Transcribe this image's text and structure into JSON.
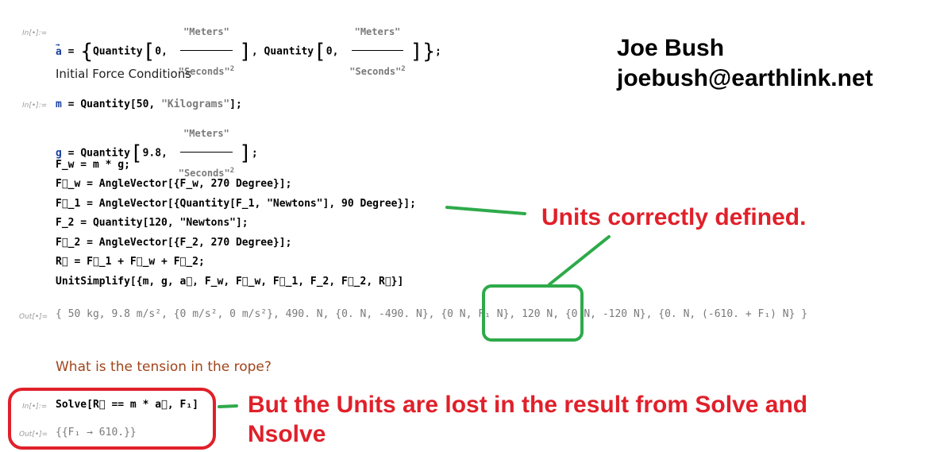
{
  "notebook": {
    "in_label": "In[•]:=",
    "out_label": "Out[•]=",
    "cells": {
      "accel": {
        "var": "a",
        "fn": "Quantity",
        "value": "0",
        "num_unit": "\"Meters\"",
        "den_unit": "\"Seconds\"",
        "exp": "2"
      },
      "text_initial": "Initial Force Conditions",
      "mass": {
        "var": "m",
        "code": "Quantity[50, ",
        "unit": "\"Kilograms\"",
        "end": "];"
      },
      "grav": {
        "var": "g",
        "fn": "Quantity",
        "value": "9.8",
        "num_unit": "\"Meters\"",
        "den_unit": "\"Seconds\"",
        "exp": "2"
      },
      "lines": [
        "F_w = m * g;",
        "F⃗_w = AngleVector[{F_w, 270 Degree}];",
        "F⃗_1 = AngleVector[{Quantity[F_1, \"Newtons\"], 90 Degree}];",
        "F_2 = Quantity[120, \"Newtons\"];",
        "F⃗_2 = AngleVector[{F_2, 270 Degree}];",
        "R⃗ = F⃗_1 + F⃗_w + F⃗_2;",
        "UnitSimplify[{m, g, a⃗, F_w, F⃗_w, F⃗_1, F_2, F⃗_2, R⃗}]"
      ],
      "output_items": [
        "50 kg",
        "9.8 m/s²",
        "{0 m/s², 0 m/s²}",
        "490. N",
        "{0. N, -490. N}",
        "{0 N, F₁ N}",
        "120 N",
        "{0 N, -120 N}",
        "{0. N, (-610. + F₁) N}"
      ],
      "section_title": "What is the tension in the rope?",
      "solve_input": "Solve[R⃗ == m * a⃗, F₁]",
      "solve_output": "{{F₁ → 610.}}"
    }
  },
  "annotations": {
    "author_name": "Joe Bush",
    "author_email": "joebush@earthlink.net",
    "note_units_defined": "Units correctly defined.",
    "note_units_lost_line1": "But the Units are lost in the result from Solve and",
    "note_units_lost_line2": "Nsolve",
    "colors": {
      "note_red": "#e0202a",
      "highlight_green": "#2eaa4a",
      "box_red": "#e0202a"
    }
  }
}
